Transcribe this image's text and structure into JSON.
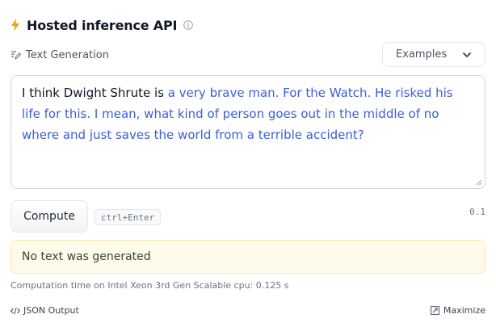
{
  "header": {
    "title": "Hosted inference API"
  },
  "task": {
    "label": "Text Generation"
  },
  "examples": {
    "label": "Examples"
  },
  "input": {
    "prompt": "I think Dwight Shrute is ",
    "generated": "a very brave man. For the Watch. He risked his life for this. I mean, what kind of person goes out in the middle of no where and just saves the world from a terrible accident?"
  },
  "compute": {
    "label": "Compute",
    "shortcut": "ctrl+Enter"
  },
  "version": "0.1",
  "alert": {
    "text": "No text was generated"
  },
  "footer": {
    "computation_time": "Computation time on Intel Xeon 3rd Gen Scalable cpu: 0.125 s",
    "json_output": "JSON Output",
    "maximize": "Maximize"
  },
  "colors": {
    "accent": "#f59e0b",
    "generated_text": "#3b5fd6",
    "alert_bg": "#fefbea"
  }
}
